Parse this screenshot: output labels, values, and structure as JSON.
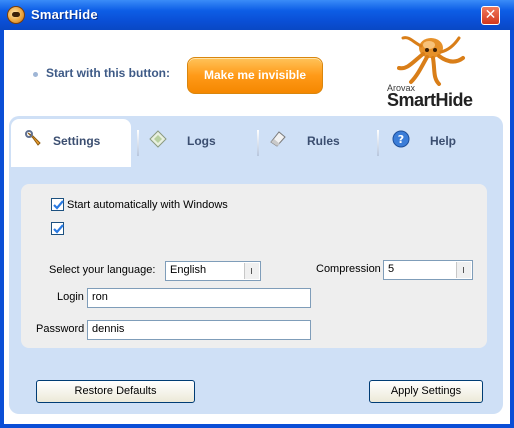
{
  "window": {
    "title": "SmartHide"
  },
  "header": {
    "start_label": "Start with this button:",
    "invisible_button": "Make me invisible",
    "logo_top": "Arovax",
    "logo_main": "SmartHide"
  },
  "tabs": [
    {
      "label": "Settings",
      "icon": "wrench-icon",
      "active": true
    },
    {
      "label": "Logs",
      "icon": "log-diamond-icon",
      "active": false
    },
    {
      "label": "Rules",
      "icon": "eraser-icon",
      "active": false
    },
    {
      "label": "Help",
      "icon": "help-icon",
      "active": false
    }
  ],
  "settings": {
    "autostart_label": "Start automatically with Windows",
    "autostart_checked": true,
    "second_checked": true,
    "language_label": "Select your language:",
    "language_value": "English",
    "compression_label": "Compression",
    "compression_value": "5",
    "login_label": "Login",
    "login_value": "ron",
    "password_label": "Password",
    "password_value": "dennis"
  },
  "buttons": {
    "restore_defaults": "Restore Defaults",
    "apply_settings": "Apply Settings"
  },
  "colors": {
    "titlebar": "#0a4ed6",
    "accent_orange": "#ff9a18",
    "tab_panel": "#cfe0f6",
    "content_bg": "#eeeeee"
  }
}
